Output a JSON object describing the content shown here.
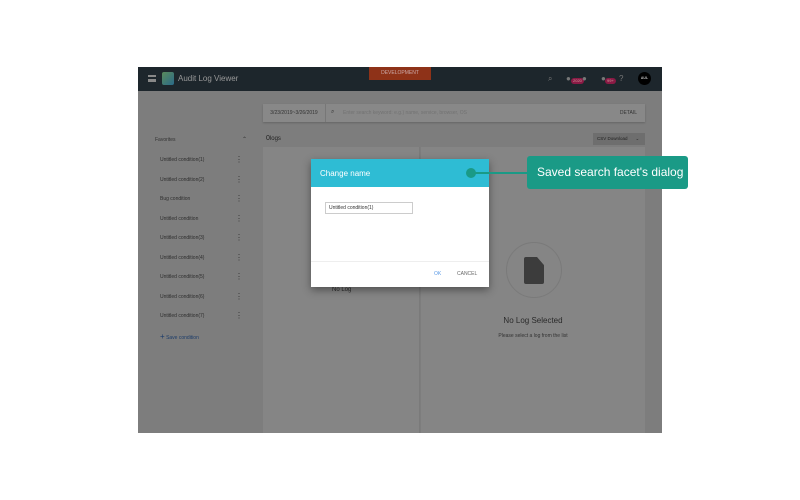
{
  "header": {
    "title": "Audit Log Viewer",
    "environment": "DEVELOPMENT",
    "badges": [
      "2020",
      "99+"
    ],
    "avatar": "AUL"
  },
  "search": {
    "date_range": "3/23/2019~3/26/2019",
    "placeholder": "Enter search keyword: e.g.) name, service, browser, OS",
    "detail_label": "DETAIL"
  },
  "sidebar": {
    "section": "Favorites",
    "items": [
      "Untitled condition(1)",
      "Untitled condition(2)",
      "Bug condition",
      "Untitled condition",
      "Untitled condition(3)",
      "Untitled condition(4)",
      "Untitled condition(5)",
      "Untitled condition(6)",
      "Untitled condition(7)"
    ],
    "save_label": "Save condition"
  },
  "main": {
    "count": "0",
    "count_label": "logs",
    "csv_label": "CSV Download",
    "no_log": "No Log",
    "no_log_selected": "No Log Selected",
    "no_log_hint": "Please select a log from the list"
  },
  "dialog": {
    "title": "Change name",
    "value": "Untitled condition(1)",
    "ok": "OK",
    "cancel": "CANCEL",
    "accent": "#2ebcd4"
  },
  "callout": {
    "text": "Saved search facet's dialog",
    "color": "#1a9a86"
  }
}
